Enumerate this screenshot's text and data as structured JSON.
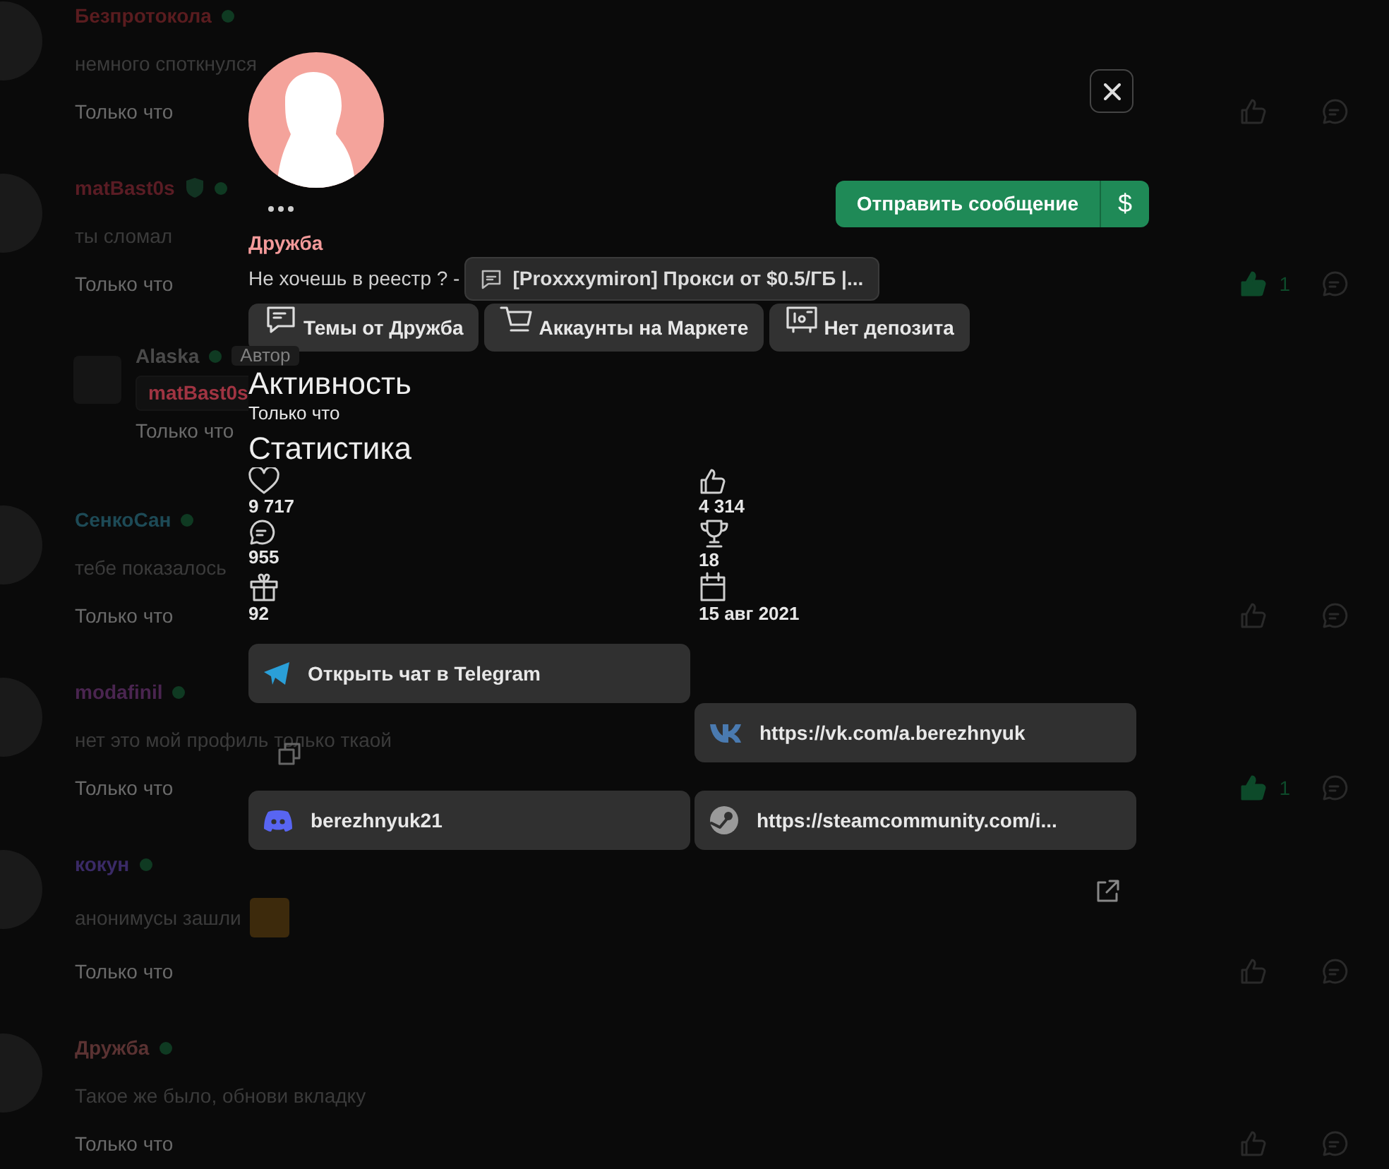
{
  "chat": {
    "messages": [
      {
        "kind": "message",
        "author": "Безпротокола",
        "color": "#5a1c1f",
        "text": "немного споткнулся",
        "time": "Только что",
        "liked": false
      },
      {
        "kind": "message",
        "author": "matBast0s",
        "color": "#5a1c24",
        "verified": true,
        "text": "ты сломал",
        "time": "Только что",
        "liked": true,
        "likes": "1"
      },
      {
        "kind": "reply",
        "author": "Alaska",
        "color": "#4a4a4a",
        "badge": "Автор",
        "quote_author": "matBast0s",
        "time": "Только что"
      },
      {
        "kind": "message",
        "author": "СенкоСан",
        "color": "#1d4a56",
        "text": "тебе показалось",
        "time": "Только что",
        "liked": false
      },
      {
        "kind": "message",
        "author": "modafinil",
        "color": "#4a2550",
        "text": "нет это мой профиль только ткаой",
        "time": "Только что",
        "liked": true,
        "likes": "1"
      },
      {
        "kind": "message",
        "author": "кокун",
        "color": "#3a2a66",
        "text": "анонимусы зашли",
        "sticker": true,
        "time": "Только что",
        "liked": false
      },
      {
        "kind": "message",
        "author": "Дружба",
        "color": "#5a3232",
        "text": "Такое же было, обнови вкладку",
        "time": "Только что",
        "liked": false
      }
    ]
  },
  "profile": {
    "name": "Дружба",
    "status_text": "Не хочешь в реестр ? -",
    "status_link": "[Proxxxymiron] Прокси от $0.5/ГБ |...",
    "send_button": "Отправить сообщение",
    "tip_button": "$",
    "buttons": [
      {
        "kind": "threads",
        "label": "Темы от Дружба"
      },
      {
        "kind": "market",
        "label": "Аккаунты на Маркете"
      },
      {
        "kind": "deposit",
        "label": "Нет депозита"
      }
    ],
    "activity": {
      "heading": "Активность",
      "value": "Только что"
    },
    "stats": {
      "heading": "Статистика",
      "items": [
        {
          "kind": "likes",
          "value": "9 717"
        },
        {
          "kind": "thumbs",
          "value": "4 314"
        },
        {
          "kind": "messages",
          "value": "955"
        },
        {
          "kind": "trophies",
          "value": "18"
        },
        {
          "kind": "gifts",
          "value": "92"
        },
        {
          "kind": "registered",
          "value": "15 авг 2021"
        }
      ]
    },
    "contacts": [
      {
        "kind": "telegram",
        "label": "Открыть чат в Telegram"
      },
      {
        "kind": "vk",
        "label": "https://vk.com/a.berezhnyuk"
      },
      {
        "kind": "discord",
        "label": "berezhnyuk21"
      },
      {
        "kind": "steam",
        "label": "https://steamcommunity.com/i..."
      }
    ]
  }
}
